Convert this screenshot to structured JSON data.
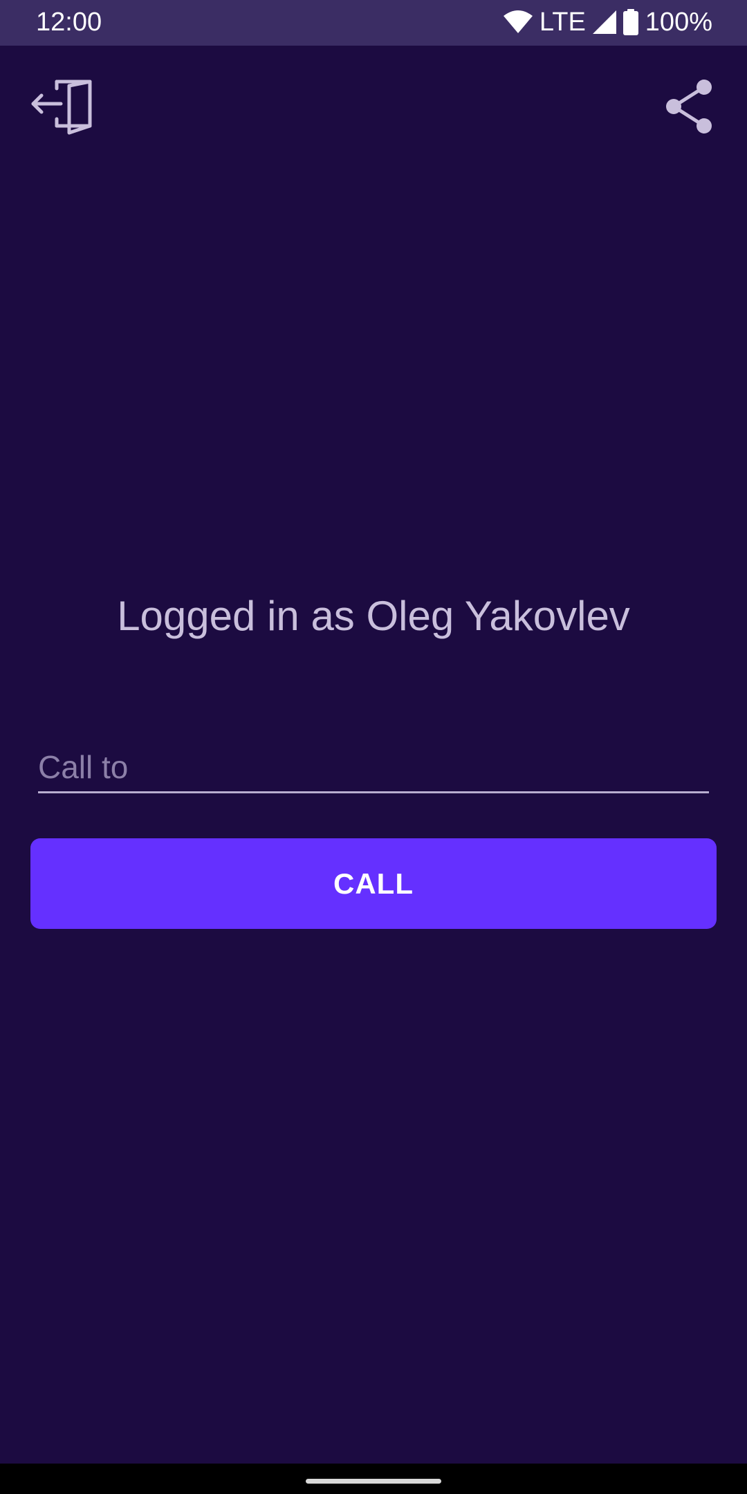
{
  "status_bar": {
    "time": "12:00",
    "network": "LTE",
    "battery": "100%",
    "icons": [
      "wifi-icon",
      "signal-icon",
      "battery-icon"
    ]
  },
  "toolbar": {
    "logout_icon": "logout-door-icon",
    "share_icon": "share-icon"
  },
  "main": {
    "logged_in_text": "Logged in as Oleg Yakovlev",
    "call_input": {
      "value": "",
      "placeholder": "Call to"
    },
    "call_button_label": "CALL"
  },
  "colors": {
    "background": "#1c0b41",
    "status_bar": "#3b2d64",
    "accent": "#6530ff",
    "text_muted": "#c9bfdc"
  }
}
